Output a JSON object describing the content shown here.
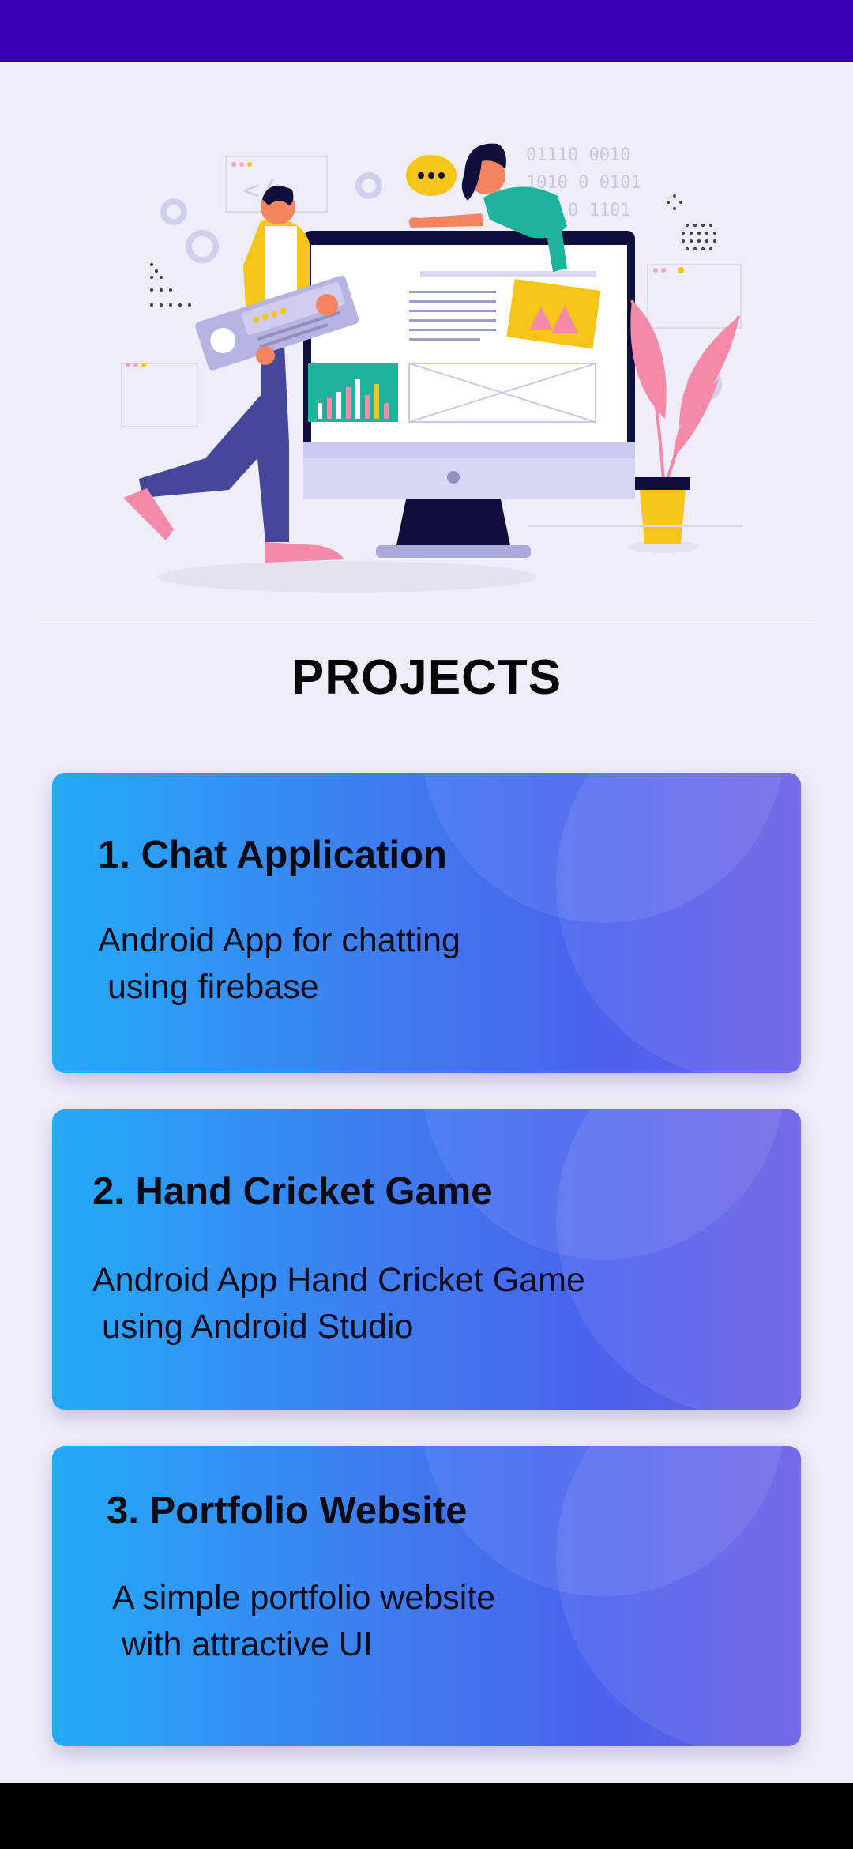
{
  "header": {
    "section_title": "PROJECTS"
  },
  "hero": {
    "binary_lines": [
      "01110 0010",
      "1010 0 0101",
      "1 0 0 1101"
    ]
  },
  "projects": [
    {
      "title": "1. Chat Application",
      "description": "Android App for chatting\n using firebase"
    },
    {
      "title": "2. Hand Cricket Game",
      "description": "Android App Hand Cricket Game\n using Android Studio"
    },
    {
      "title": "3. Portfolio Website",
      "description": "A simple portfolio website\n with attractive UI"
    }
  ],
  "colors": {
    "status_bar": "#3700b3",
    "background": "#efedf9",
    "card_gradient_start": "#23abf7",
    "card_gradient_end": "#6b5ee6",
    "nav_bar": "#000000"
  }
}
